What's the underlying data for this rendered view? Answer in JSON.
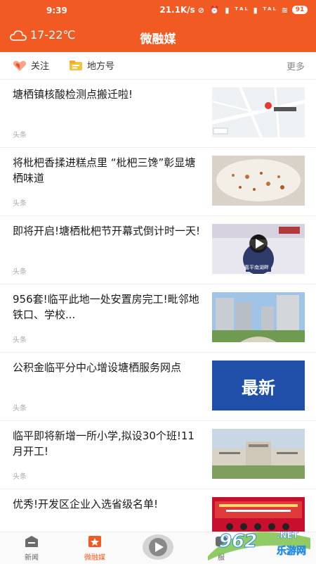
{
  "status": {
    "time": "9:39",
    "speed": "21.1K/s",
    "icons": "⊘ ⏰ ▮ ᵀᴬᴸ ▮ ᵀᴬᴸ ≋",
    "battery": "91"
  },
  "header": {
    "weather_icon": "cloud-icon",
    "temperature": "17-22℃",
    "title": "微融媒"
  },
  "tabs": [
    {
      "label": "关注",
      "icon": "heart-icon"
    },
    {
      "label": "地方号",
      "icon": "folder-icon"
    }
  ],
  "more_label": "更多",
  "feed": [
    {
      "title": "塘栖镇核酸检测点搬迁啦!",
      "source": "头条"
    },
    {
      "title": "将枇杷香揉进糕点里 “枇杷三馋”彰显塘栖味道",
      "source": "头条"
    },
    {
      "title": "即将开启!塘栖枇杷节开幕式倒计时一天!",
      "source": "头条",
      "thumb_caption": "嘉平南湖畔"
    },
    {
      "title": "956套!临平此地一处安置房完工!毗邻地铁口、学校...",
      "source": "头条"
    },
    {
      "title": "公积金临平分中心增设塘栖服务网点",
      "source": "头条",
      "thumb_text": "最新"
    },
    {
      "title": "临平即将新增一所小学,拟设30个班!11月开工!",
      "source": "头条"
    },
    {
      "title": "优秀!开发区企业入选省级名单!",
      "source": ""
    }
  ],
  "bottom_nav": [
    {
      "label": "新闻",
      "icon": "news-icon"
    },
    {
      "label": "微融媒",
      "icon": "media-icon"
    },
    {
      "label": "",
      "icon": "play-icon"
    },
    {
      "label": "服",
      "icon": "service-icon"
    }
  ],
  "watermark": {
    "number": "962",
    "site": "乐游网",
    "domain": ".NET"
  },
  "colors": {
    "brand": "#f15a22"
  }
}
